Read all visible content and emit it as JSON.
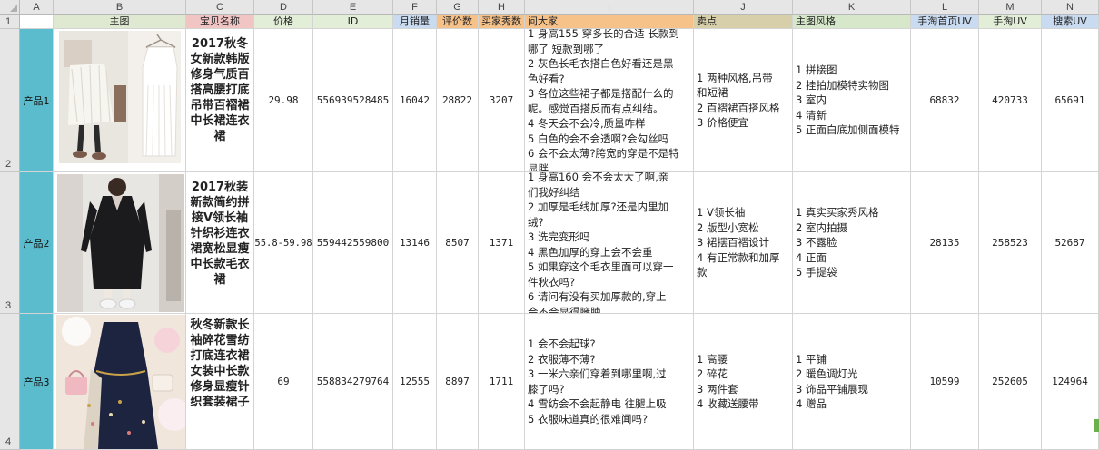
{
  "sheet": {
    "column_letters": [
      "A",
      "B",
      "C",
      "D",
      "E",
      "F",
      "G",
      "H",
      "I",
      "J",
      "K",
      "L",
      "M",
      "N"
    ],
    "row_numbers": [
      "1",
      "2",
      "3",
      "4"
    ],
    "headers": {
      "image": "主图",
      "name": "宝贝名称",
      "price": "价格",
      "id": "ID",
      "monthly_sales": "月销量",
      "reviews": "评价数",
      "buyer_shows": "买家秀数",
      "questions": "问大家",
      "selling_points": "卖点",
      "image_style": "主图风格",
      "home_uv": "手淘首页UV",
      "taobao_uv": "手淘UV",
      "search_uv": "搜索UV"
    },
    "header_colors": {
      "image": "#dfe9d2",
      "name": "#f2c5c5",
      "price": "#e3eed8",
      "id": "#e3eed8",
      "monthly_sales": "#c9dbf0",
      "reviews": "#f6c28a",
      "buyer_shows": "#f6c28a",
      "questions": "#f6c28a",
      "selling_points": "#d6cfa9",
      "image_style": "#d6e8c9",
      "home_uv": "#c9dbf0",
      "taobao_uv": "#e3eed8",
      "search_uv": "#c9dbf0"
    },
    "products": [
      {
        "label": "产品1",
        "image_icon": "dress-photo-white-knit-and-slip",
        "name": "2017秋冬女新款韩版修身气质百搭高腰打底吊带百褶裙中长裙连衣裙",
        "price": "29.98",
        "id": "556939528485",
        "monthly_sales": "16042",
        "reviews": "28822",
        "buyer_shows": "3207",
        "questions": [
          "1 身高155 穿多长的合适 长款到",
          "哪了 短款到哪了",
          "2 灰色长毛衣搭白色好看还是黑",
          "色好看?",
          "3 各位这些裙子都是搭配什么的",
          "呢。感觉百搭反而有点纠结。",
          "4 冬天会不会冷,质量咋样",
          "5 白色的会不会透啊?会勾丝吗",
          "6 会不会太薄?胯宽的穿是不是特",
          "显胖"
        ],
        "selling_points": [
          "1 两种风格,吊带",
          "和短裙",
          "2 百褶裙百搭风格",
          "3 价格便宜"
        ],
        "image_style": [
          "1 拼接图",
          "2 挂拍加模特实物图",
          "3 室内",
          "4 清新",
          "5 正面白底加侧面模特"
        ],
        "home_uv": "68832",
        "taobao_uv": "420733",
        "search_uv": "65691"
      },
      {
        "label": "产品2",
        "image_icon": "dress-photo-black-knit-long",
        "name": "2017秋装新款简约拼接V领长袖针织衫连衣裙宽松显瘦中长款毛衣裙",
        "price": "55.8-59.98",
        "id": "559442559800",
        "monthly_sales": "13146",
        "reviews": "8507",
        "buyer_shows": "1371",
        "questions": [
          "1 身高160 会不会太大了啊,亲",
          "们我好纠结",
          "2 加厚是毛线加厚?还是内里加",
          "绒?",
          "3 洗完变形吗",
          "4 黑色加厚的穿上会不会重",
          "5 如果穿这个毛衣里面可以穿一",
          "件秋衣吗?",
          "6 请问有没有买加厚款的,穿上",
          "会不会显得臃肿"
        ],
        "selling_points": [
          "1 V领长袖",
          "2 版型小宽松",
          "3 裙摆百褶设计",
          "4 有正常款和加厚",
          "款"
        ],
        "image_style": [
          "1 真实买家秀风格",
          "2 室内拍摄",
          "3 不露脸",
          "4 正面",
          "5 手提袋"
        ],
        "home_uv": "28135",
        "taobao_uv": "258523",
        "search_uv": "52687"
      },
      {
        "label": "产品3",
        "image_icon": "dress-photo-navy-floral-set",
        "name": "秋冬新款长袖碎花雪纺打底连衣裙女装中长款修身显瘦针织套装裙子",
        "price": "69",
        "id": "558834279764",
        "monthly_sales": "12555",
        "reviews": "8897",
        "buyer_shows": "1711",
        "questions": [
          "1 会不会起球?",
          "2 衣服薄不薄?",
          "3 一米六亲们穿着到哪里啊,过",
          "膝了吗?",
          "4 雪纺会不会起静电 往腿上吸",
          "5 衣服味道真的很难闻吗?"
        ],
        "selling_points": [
          "1 高腰",
          "2 碎花",
          "3 两件套",
          "4 收藏送腰带"
        ],
        "image_style": [
          "1 平铺",
          "2 暖色调灯光",
          "3 饰品平铺展现",
          "4 赠品"
        ],
        "home_uv": "10599",
        "taobao_uv": "252605",
        "search_uv": "124964"
      }
    ]
  }
}
